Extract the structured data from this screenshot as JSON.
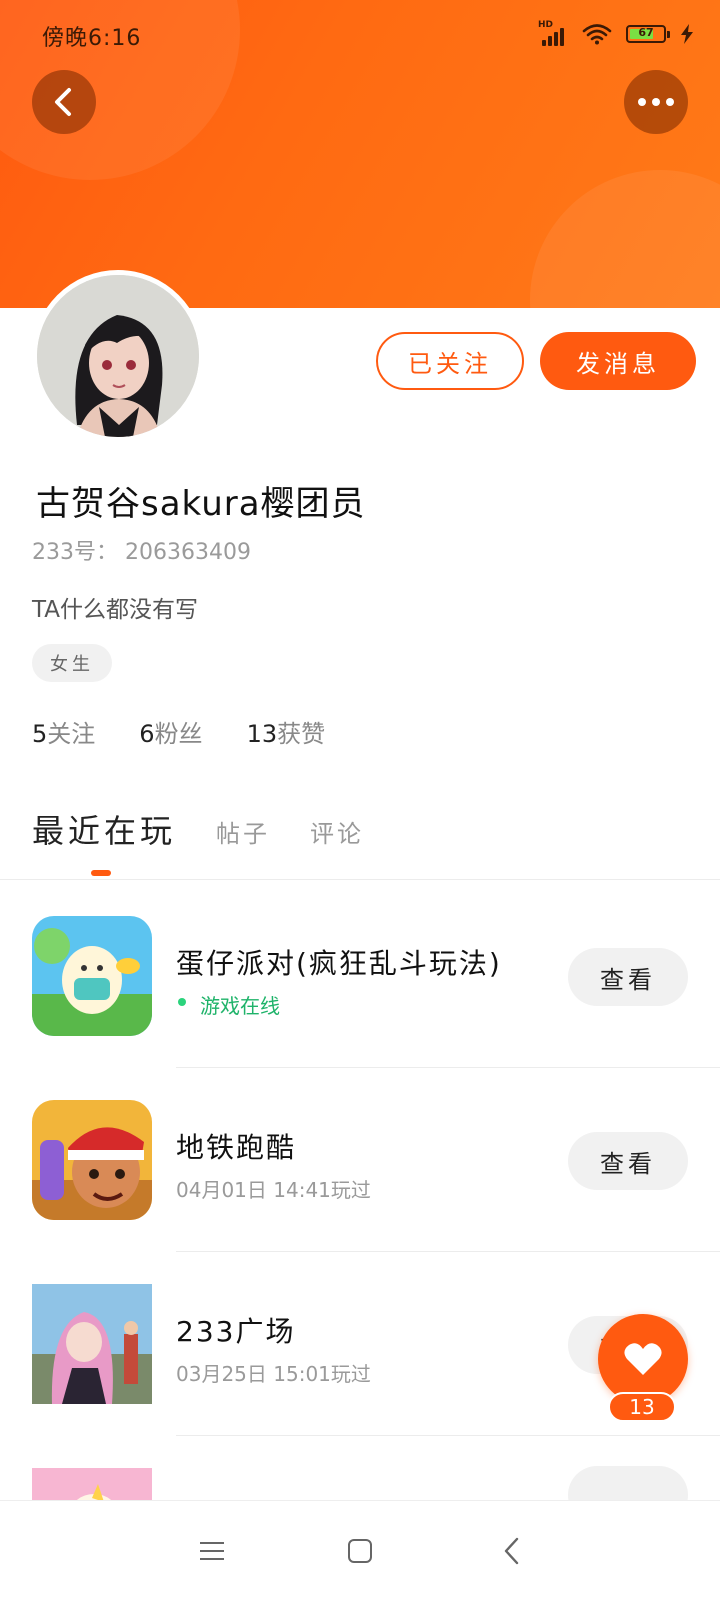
{
  "status_bar": {
    "time": "傍晚6:16",
    "network_badge": "HD",
    "battery_level": "67",
    "icons": [
      "hd-signal-icon",
      "wifi-icon",
      "battery-icon",
      "charging-bolt-icon"
    ]
  },
  "header": {
    "back_icon": "chevron-left-icon",
    "more_icon": "more-dots-icon",
    "colors": {
      "accent": "#ff5a10",
      "online_green": "#1fb36a"
    }
  },
  "profile": {
    "nickname": "古贺谷sakura樱团员",
    "uid": "233号： 206363409",
    "bio": "TA什么都没有写",
    "gender_tag": "女生",
    "follow_button": "已关注",
    "message_button": "发消息",
    "stats": {
      "following_count": "5",
      "following_label": "关注",
      "fans_count": "6",
      "fans_label": "粉丝",
      "likes_count": "13",
      "likes_label": "获赞"
    }
  },
  "tabs": {
    "recent": "最近在玩",
    "posts": "帖子",
    "comments": "评论",
    "active": "recent"
  },
  "games": [
    {
      "title": "蛋仔派对(疯狂乱斗玩法)",
      "subtitle": "游戏在线",
      "status": "online",
      "action": "查看"
    },
    {
      "title": "地铁跑酷",
      "subtitle": "04月01日 14:41玩过",
      "status": "played",
      "action": "查看"
    },
    {
      "title": "233广场",
      "subtitle": "03月25日 15:01玩过",
      "status": "played",
      "action": "查看"
    }
  ],
  "like_fab": {
    "count": "13",
    "icon": "heart-icon"
  },
  "system_nav": {
    "icons": [
      "menu-icon",
      "home-square-icon",
      "back-chevron-icon"
    ]
  }
}
